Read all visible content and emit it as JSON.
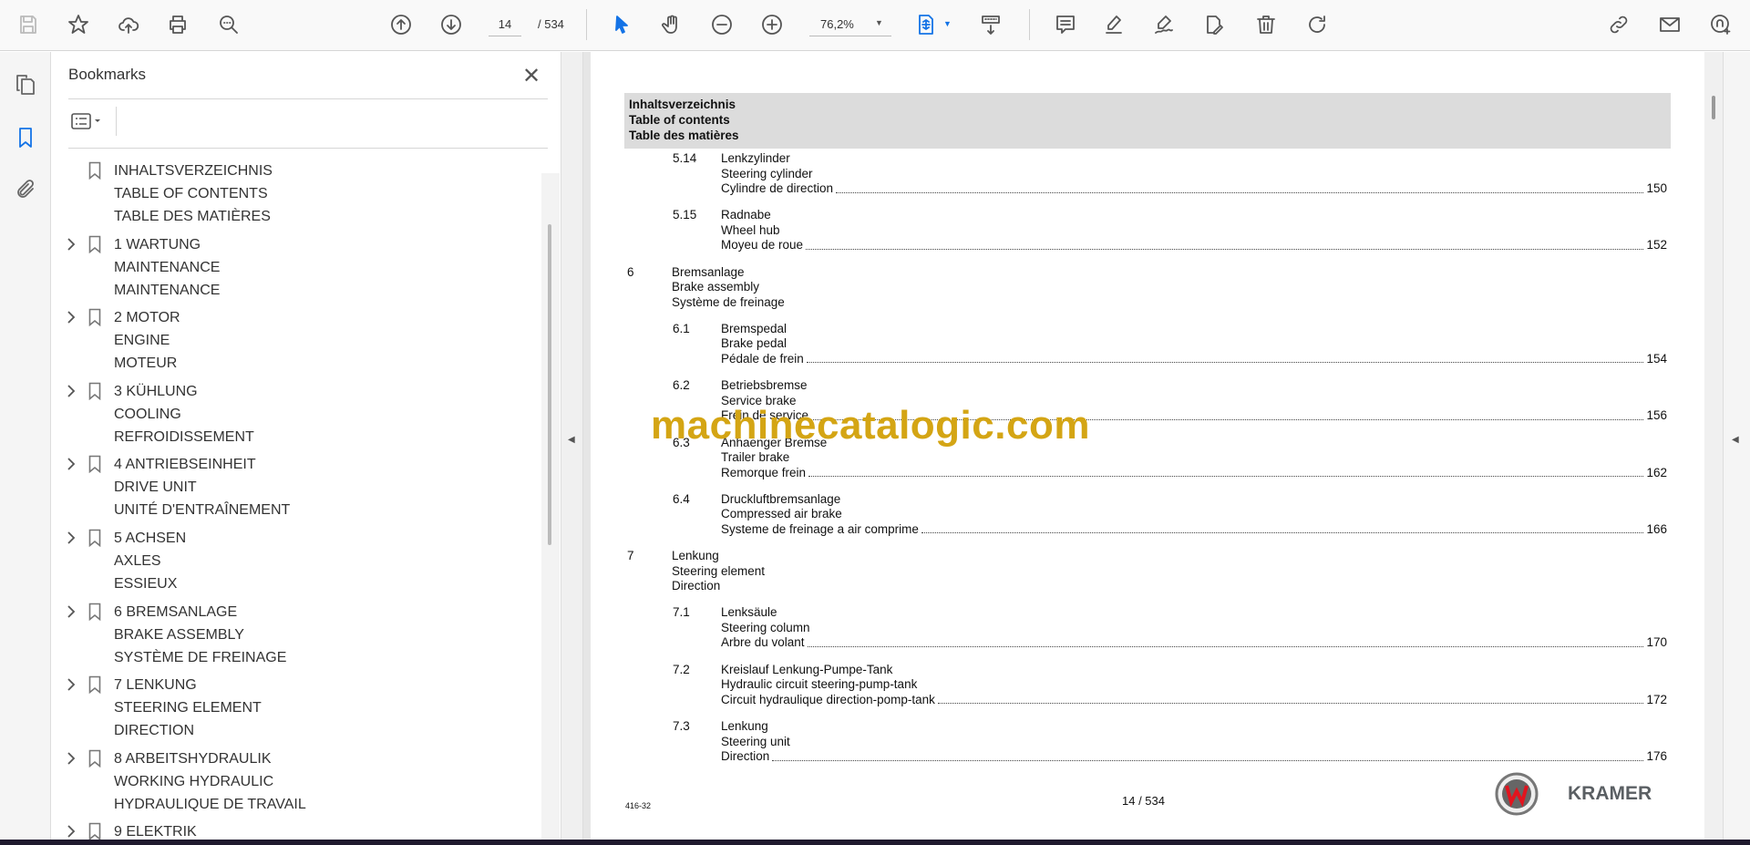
{
  "toolbar": {
    "page_current": "14",
    "page_total": "/ 534",
    "zoom": "76,2%",
    "icons": [
      "save-icon",
      "bookmark-star-icon",
      "upload-icon",
      "print-icon",
      "find-icon",
      "previous-page-icon",
      "next-page-icon",
      "select-icon",
      "hand-icon",
      "zoom-out-icon",
      "zoom-in-icon",
      "fit-page-icon",
      "scroll-mode-icon",
      "comment-icon",
      "highlight-icon",
      "sign-icon",
      "edit-icon",
      "delete-icon",
      "rotate-icon",
      "share-link-icon",
      "email-icon",
      "account-icon"
    ],
    "accent": "#1473e6"
  },
  "bookmarks": {
    "title": "Bookmarks",
    "items": [
      {
        "lines": [
          "INHALTSVERZEICHNIS",
          "TABLE OF CONTENTS",
          "TABLE DES MATIÈRES"
        ],
        "expandable": false
      },
      {
        "lines": [
          "1 WARTUNG",
          "MAINTENANCE",
          "MAINTENANCE"
        ],
        "expandable": true
      },
      {
        "lines": [
          "2 MOTOR",
          "ENGINE",
          "MOTEUR"
        ],
        "expandable": true
      },
      {
        "lines": [
          "3 KÜHLUNG",
          "COOLING",
          "REFROIDISSEMENT"
        ],
        "expandable": true
      },
      {
        "lines": [
          "4 ANTRIEBSEINHEIT",
          "DRIVE UNIT",
          "UNITÉ D'ENTRAÎNEMENT"
        ],
        "expandable": true
      },
      {
        "lines": [
          "5 ACHSEN",
          "AXLES",
          "ESSIEUX"
        ],
        "expandable": true
      },
      {
        "lines": [
          "6 BREMSANLAGE",
          "BRAKE ASSEMBLY",
          "SYSTÈME DE FREINAGE"
        ],
        "expandable": true
      },
      {
        "lines": [
          "7 LENKUNG",
          "STEERING ELEMENT",
          "DIRECTION"
        ],
        "expandable": true
      },
      {
        "lines": [
          "8 ARBEITSHYDRAULIK",
          "WORKING HYDRAULIC",
          "HYDRAULIQUE DE TRAVAIL"
        ],
        "expandable": true
      },
      {
        "lines": [
          "9 ELEKTRIK"
        ],
        "expandable": true
      }
    ]
  },
  "document": {
    "header": [
      "Inhaltsverzeichnis",
      "Table of contents",
      "Table des matières"
    ],
    "entries": [
      {
        "num": "5.14",
        "level": 2,
        "lines": [
          "Lenkzylinder",
          "Steering cylinder",
          "Cylindre de direction"
        ],
        "page": "150"
      },
      {
        "num": "5.15",
        "level": 2,
        "lines": [
          "Radnabe",
          "Wheel hub",
          "Moyeu de roue"
        ],
        "page": "152"
      },
      {
        "num": "6",
        "level": 1,
        "lines": [
          "Bremsanlage",
          "Brake assembly",
          "Système de freinage"
        ],
        "page": ""
      },
      {
        "num": "6.1",
        "level": 2,
        "lines": [
          "Bremspedal",
          "Brake pedal",
          "Pédale de frein"
        ],
        "page": "154"
      },
      {
        "num": "6.2",
        "level": 2,
        "lines": [
          "Betriebsbremse",
          "Service brake",
          "Frein de service"
        ],
        "page": "156"
      },
      {
        "num": "6.3",
        "level": 2,
        "lines": [
          "Anhaenger Bremse",
          "Trailer brake",
          "Remorque frein"
        ],
        "page": "162"
      },
      {
        "num": "6.4",
        "level": 2,
        "lines": [
          "Druckluftbremsanlage",
          "Compressed air brake",
          "Systeme de freinage a air comprime"
        ],
        "page": "166"
      },
      {
        "num": "7",
        "level": 1,
        "lines": [
          "Lenkung",
          "Steering element",
          "Direction"
        ],
        "page": ""
      },
      {
        "num": "7.1",
        "level": 2,
        "lines": [
          "Lenksäule",
          "Steering column",
          "Arbre du volant"
        ],
        "page": "170"
      },
      {
        "num": "7.2",
        "level": 2,
        "lines": [
          "Kreislauf Lenkung-Pumpe-Tank",
          "Hydraulic circuit steering-pump-tank",
          "Circuit hydraulique direction-pomp-tank"
        ],
        "page": "172"
      },
      {
        "num": "7.3",
        "level": 2,
        "lines": [
          "Lenkung",
          "Steering unit",
          "Direction"
        ],
        "page": "176"
      }
    ],
    "footer_code": "416-32",
    "footer_page": "14 / 534",
    "brand": "KRAMER",
    "watermark": "machinecatalogic.com"
  }
}
